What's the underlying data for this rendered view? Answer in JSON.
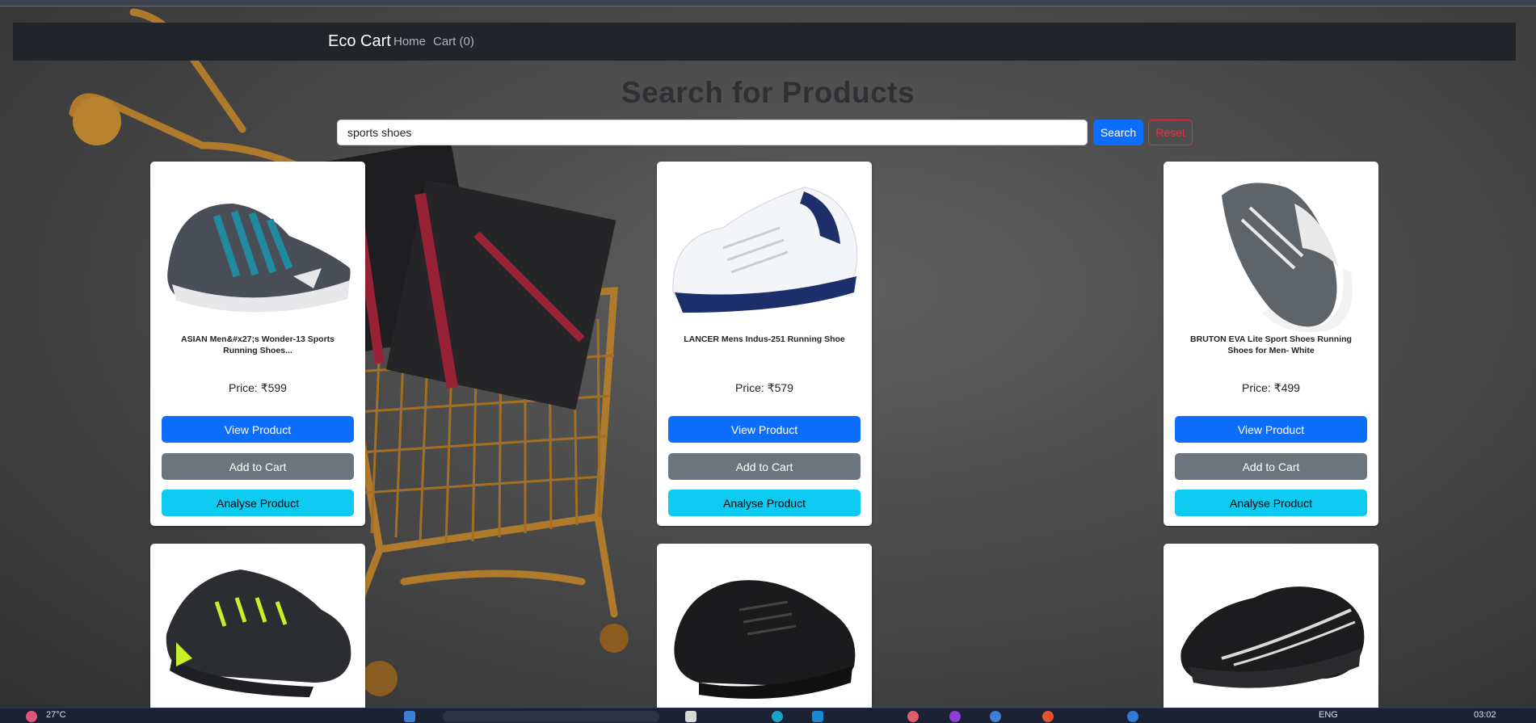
{
  "navbar": {
    "brand": "Eco Cart",
    "links": [
      "Home",
      "Cart (0)"
    ]
  },
  "page_title": "Search for Products",
  "search": {
    "value": "sports shoes",
    "search_label": "Search",
    "reset_label": "Reset"
  },
  "products": [
    {
      "name": "ASIAN Men&#x27;s Wonder-13 Sports Running Shoes...",
      "price": "Price: ₹599",
      "view": "View Product",
      "add": "Add to Cart",
      "analyse": "Analyse Product",
      "shoe_color": "#4a4f57",
      "accent": "#1f8aa0",
      "sole": "#e8e8ea"
    },
    {
      "name": "LANCER Mens Indus-251 Running Shoe",
      "price": "Price: ₹579",
      "view": "View Product",
      "add": "Add to Cart",
      "analyse": "Analyse Product",
      "shoe_color": "#f4f5f8",
      "accent": "#1d2f6b",
      "sole": "#1d2f6b"
    },
    {
      "name": "BRUTON EVA Lite Sport Shoes Running Shoes for Men- White",
      "price": "Price: ₹499",
      "view": "View Product",
      "add": "Add to Cart",
      "analyse": "Analyse Product",
      "shoe_color": "#5f6468",
      "accent": "#e9e9e9",
      "sole": "#f2f2f2"
    },
    {
      "name": "",
      "price": "",
      "view": "",
      "add": "",
      "analyse": "",
      "shoe_color": "#2b2d31",
      "accent": "#c8f02a",
      "sole": "#2b2d31"
    },
    {
      "name": "",
      "price": "",
      "view": "",
      "add": "",
      "analyse": "",
      "shoe_color": "#1b1b1d",
      "accent": "#444",
      "sole": "#111"
    },
    {
      "name": "",
      "price": "",
      "view": "",
      "add": "",
      "analyse": "",
      "shoe_color": "#1c1c1e",
      "accent": "#d9d9d9",
      "sole": "#1c1c1e"
    }
  ],
  "taskbar": {
    "weather": "27°C",
    "lang": "ENG",
    "time": "03:02"
  },
  "colors": {
    "navbar": "#212529",
    "primary": "#0d6efd",
    "secondary": "#6c757d",
    "info": "#0dcaf0",
    "danger": "#dc3545"
  }
}
